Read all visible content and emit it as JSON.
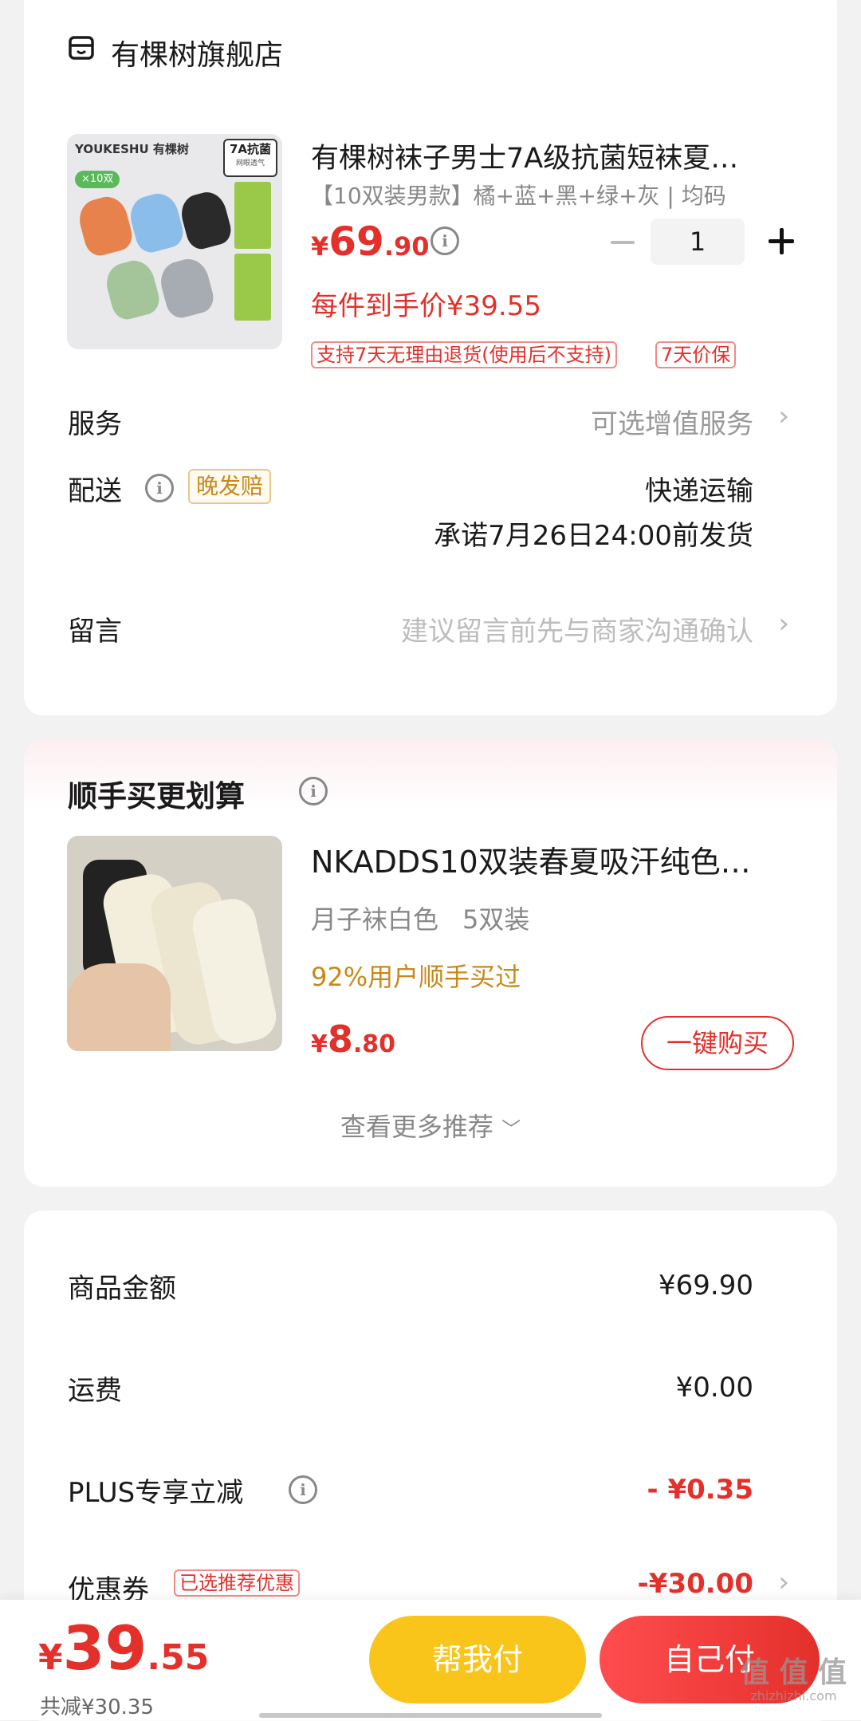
{
  "store": {
    "name": "有棵树旗舰店",
    "icon": "store-icon"
  },
  "product": {
    "image_brand": "YOUKESHU 有棵树",
    "image_badge": "7A抗菌",
    "image_badge_sub": "网眼透气",
    "image_count": "×10双",
    "title": "有棵树袜子男士7A级抗菌短袜夏…",
    "spec": "【10双装男款】橘+蓝+黑+绿+灰 | 均码",
    "price_symbol": "¥",
    "price_int": "69",
    "price_dec": ".90",
    "quantity": "1",
    "unit_price_label": "每件到手价¥39.55",
    "tags": [
      "支持7天无理由退货(使用后不支持)",
      "7天价保"
    ]
  },
  "service": {
    "label": "服务",
    "value": "可选增值服务"
  },
  "delivery": {
    "label": "配送",
    "badge": "晚发赔",
    "method": "快递运输",
    "promise": "承诺7月26日24:00前发货"
  },
  "message": {
    "label": "留言",
    "placeholder": "建议留言前先与商家沟通确认"
  },
  "addon": {
    "title": "顺手买更划算",
    "product_title": "NKADDS10双装春夏吸汗纯色…",
    "spec1": "月子袜白色",
    "spec2": "5双装",
    "social": "92%用户顺手买过",
    "price_symbol": "¥",
    "price_int": "8",
    "price_dec": ".80",
    "buy_label": "一键购买",
    "more_label": "查看更多推荐"
  },
  "summary": {
    "rows": [
      {
        "label": "商品金额",
        "value": "¥69.90"
      },
      {
        "label": "运费",
        "value": "¥0.00"
      },
      {
        "label": "PLUS专享立减",
        "value": "- ¥0.35"
      },
      {
        "label": "优惠券",
        "badge": "已选推荐优惠",
        "value": "-¥30.00"
      }
    ]
  },
  "footer": {
    "price_symbol": "¥",
    "price_int": "39",
    "price_dec": ".55",
    "saved": "共减¥30.35",
    "help_pay": "帮我付",
    "self_pay": "自己付",
    "watermark": "值 值 值",
    "watermark_sub": "zhizhizhi.com"
  },
  "colors": {
    "accent": "#e4302b",
    "help_pay_bg": "#f9c51b",
    "gold": "#c8891a"
  }
}
